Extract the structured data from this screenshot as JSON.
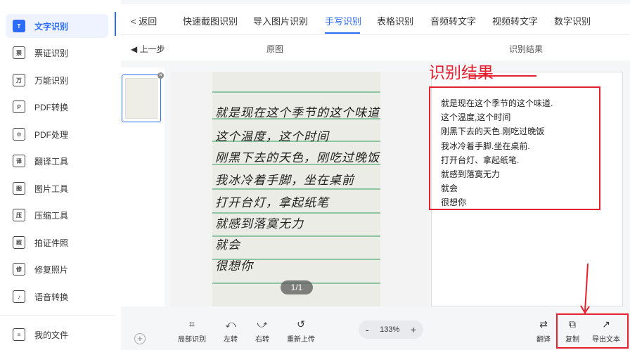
{
  "sidebar": {
    "items": [
      {
        "label": "文字识别",
        "icon": "T"
      },
      {
        "label": "票证识别",
        "icon": "票"
      },
      {
        "label": "万能识别",
        "icon": "万"
      },
      {
        "label": "PDF转换",
        "icon": "P"
      },
      {
        "label": "PDF处理",
        "icon": "⚙"
      },
      {
        "label": "翻译工具",
        "icon": "译"
      },
      {
        "label": "图片工具",
        "icon": "图"
      },
      {
        "label": "压缩工具",
        "icon": "压"
      },
      {
        "label": "拍证件照",
        "icon": "照"
      },
      {
        "label": "修复照片",
        "icon": "修"
      },
      {
        "label": "语音转换",
        "icon": "♪"
      }
    ],
    "my_files": "我的文件"
  },
  "tabs": {
    "back": "< 返回",
    "items": [
      "快速截图识别",
      "导入图片识别",
      "手写识别",
      "表格识别",
      "音频转文字",
      "视频转文字",
      "数字识别"
    ],
    "active": "手写识别"
  },
  "subbar": {
    "prev_step": "◀ 上一步",
    "original": "原图",
    "result": "识别结果"
  },
  "thumb_close": "✕",
  "handwriting": [
    "就是现在这个季节的这个味道",
    "这个温度，这个时间",
    "刚黑下去的天色，刚吃过晚饭",
    "我冰冷着手脚，坐在桌前",
    "打开台灯，拿起纸笔",
    "就感到落寞无力",
    "就会",
    "很想你"
  ],
  "page_indicator": "1/1",
  "annotation": {
    "caption": "识别结果"
  },
  "result": {
    "lines": [
      "就是现在这个季节的这个味道.",
      "这个温度,这个时间",
      "刚黑下去的天色.刚吃过晚饭",
      "我冰冷着手脚.坐在桌前.",
      "打开台灯、拿起纸笔.",
      "就感到落寞无力",
      "就会",
      "很想你"
    ]
  },
  "toolbar": {
    "tools": [
      {
        "icon": "⌗",
        "label": "局部识别"
      },
      {
        "icon": "⤺",
        "label": "左转"
      },
      {
        "icon": "⤻",
        "label": "右转"
      },
      {
        "icon": "↺",
        "label": "重新上传"
      }
    ],
    "zoom": {
      "minus": "-",
      "value": "133%",
      "plus": "+"
    },
    "translate": {
      "icon": "⇄",
      "label": "翻译"
    },
    "copy": {
      "icon": "⧉",
      "label": "复制"
    },
    "export": {
      "icon": "↗",
      "label": "导出文本"
    },
    "add": "+"
  },
  "colors": {
    "accent": "#2d6cf6",
    "annotation_red": "#e5202f",
    "ruled_line": "#8dc5a0"
  }
}
